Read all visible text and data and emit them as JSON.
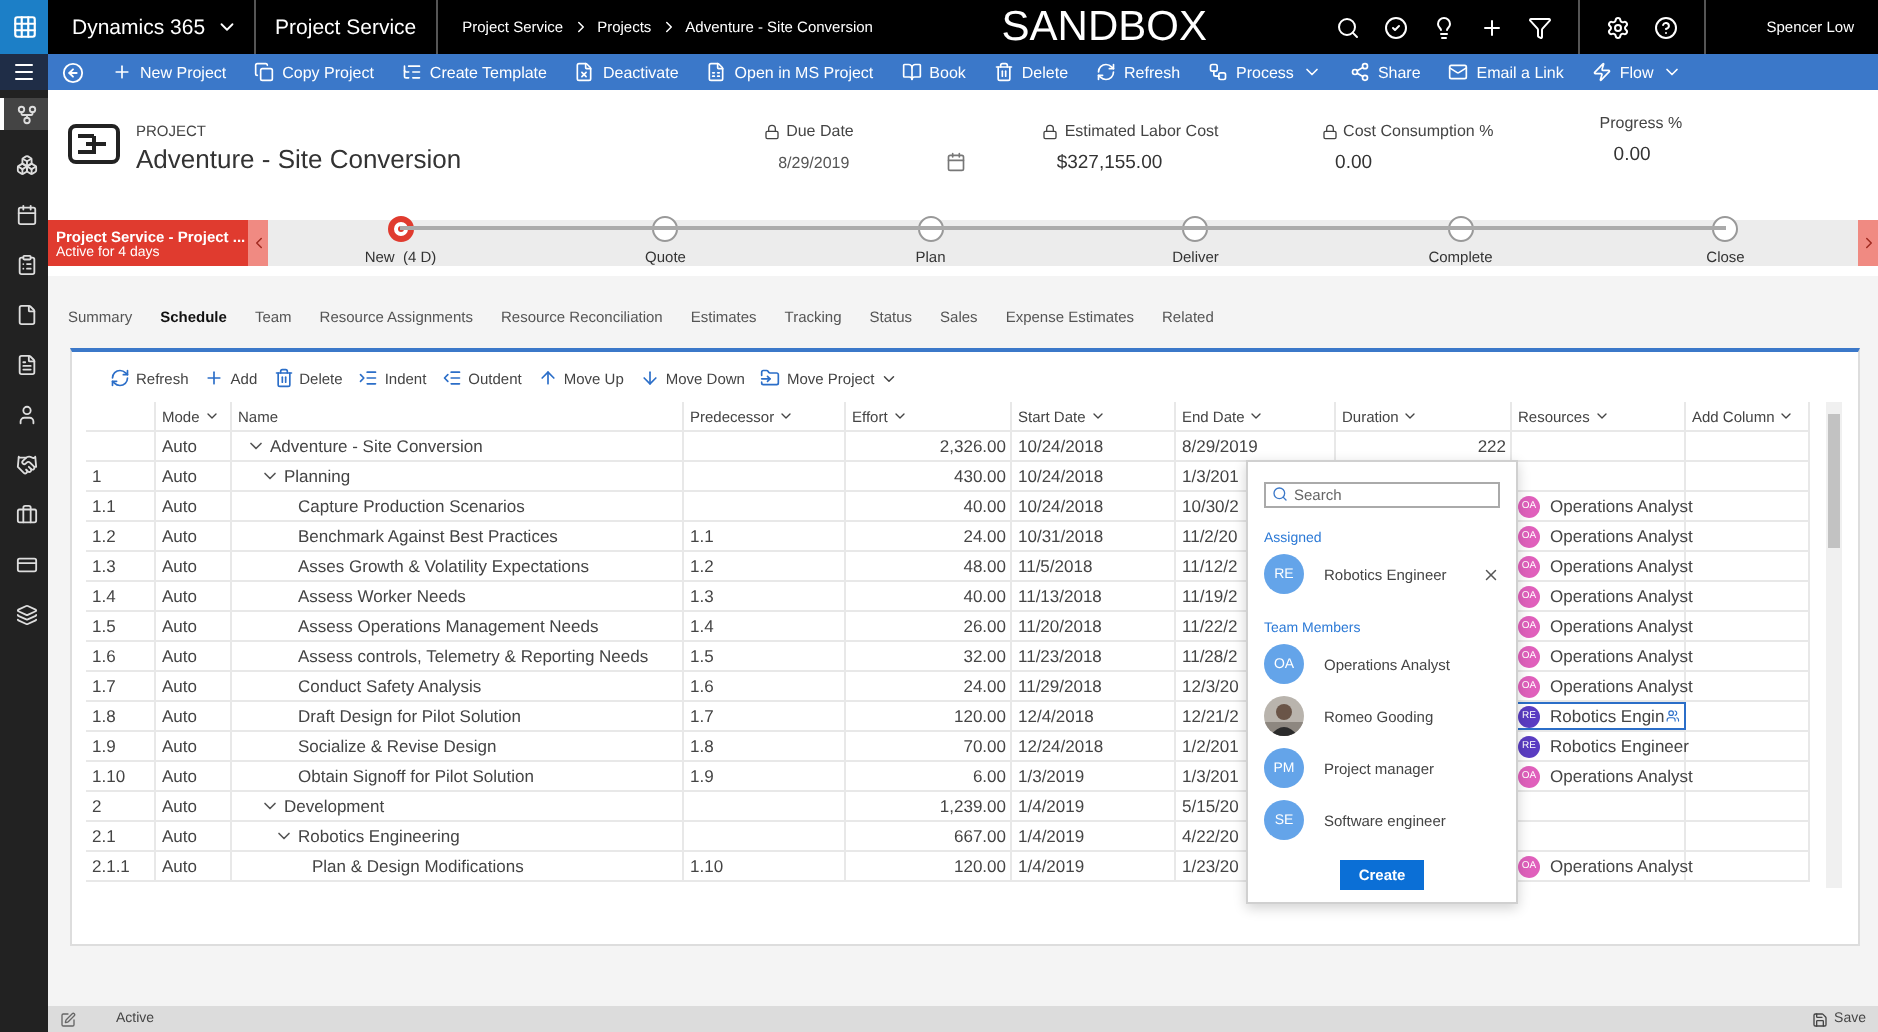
{
  "app_bar": {
    "brand": "Dynamics 365",
    "area": "Project Service",
    "breadcrumb": [
      "Project Service",
      "Projects",
      "Adventure - Site Conversion"
    ],
    "environment": "SANDBOX",
    "user": "Spencer Low"
  },
  "nav": [
    {
      "selected": true
    },
    {
      "selected": false
    },
    {
      "selected": false
    },
    {
      "selected": false
    },
    {
      "selected": false
    },
    {
      "selected": false
    },
    {
      "selected": false
    },
    {
      "selected": false
    },
    {
      "selected": false
    },
    {
      "selected": false
    },
    {
      "selected": false
    }
  ],
  "commands": [
    {
      "label": "New Project",
      "dropdown": false
    },
    {
      "label": "Copy Project",
      "dropdown": false
    },
    {
      "label": "Create Template",
      "dropdown": false
    },
    {
      "label": "Deactivate",
      "dropdown": false
    },
    {
      "label": "Open in MS Project",
      "dropdown": false
    },
    {
      "label": "Book",
      "dropdown": false
    },
    {
      "label": "Delete",
      "dropdown": false
    },
    {
      "label": "Refresh",
      "dropdown": false
    },
    {
      "label": "Process",
      "dropdown": true
    },
    {
      "label": "Share",
      "dropdown": false
    },
    {
      "label": "Email a Link",
      "dropdown": false
    },
    {
      "label": "Flow",
      "dropdown": true
    }
  ],
  "header": {
    "entity": "PROJECT",
    "name": "Adventure - Site Conversion",
    "fields": [
      {
        "label": "Due Date",
        "locked": true,
        "value": "8/29/2019",
        "kind": "date"
      },
      {
        "label": "Estimated Labor Cost",
        "locked": true,
        "value": "$327,155.00",
        "kind": "text"
      },
      {
        "label": "Cost Consumption %",
        "locked": true,
        "value": "0.00",
        "kind": "text"
      },
      {
        "label": "Progress %",
        "locked": false,
        "value": "0.00",
        "kind": "text"
      }
    ]
  },
  "process": {
    "title": "Project Service - Project ...",
    "status": "Active for 4 days",
    "stages": [
      {
        "label": "New  (4 D)",
        "selected": true
      },
      {
        "label": "Quote",
        "selected": false
      },
      {
        "label": "Plan",
        "selected": false
      },
      {
        "label": "Deliver",
        "selected": false
      },
      {
        "label": "Complete",
        "selected": false
      },
      {
        "label": "Close",
        "selected": false
      }
    ]
  },
  "tabs": [
    {
      "label": "Summary",
      "selected": false
    },
    {
      "label": "Schedule",
      "selected": true
    },
    {
      "label": "Team",
      "selected": false
    },
    {
      "label": "Resource Assignments",
      "selected": false
    },
    {
      "label": "Resource Reconciliation",
      "selected": false
    },
    {
      "label": "Estimates",
      "selected": false
    },
    {
      "label": "Tracking",
      "selected": false
    },
    {
      "label": "Status",
      "selected": false
    },
    {
      "label": "Sales",
      "selected": false
    },
    {
      "label": "Expense Estimates",
      "selected": false
    },
    {
      "label": "Related",
      "selected": false
    }
  ],
  "grid": {
    "toolbar": [
      {
        "label": "Refresh",
        "dropdown": false
      },
      {
        "label": "Add",
        "dropdown": false
      },
      {
        "label": "Delete",
        "dropdown": false
      },
      {
        "label": "Indent",
        "dropdown": false
      },
      {
        "label": "Outdent",
        "dropdown": false
      },
      {
        "label": "Move Up",
        "dropdown": false
      },
      {
        "label": "Move Down",
        "dropdown": false
      },
      {
        "label": "Move Project",
        "dropdown": true
      }
    ],
    "columns": [
      {
        "label": "Mode",
        "menu": true
      },
      {
        "label": "Name",
        "menu": false
      },
      {
        "label": "Predecessor",
        "menu": true
      },
      {
        "label": "Effort",
        "menu": true
      },
      {
        "label": "Start Date",
        "menu": true
      },
      {
        "label": "End Date",
        "menu": true
      },
      {
        "label": "Duration",
        "menu": true
      },
      {
        "label": "Resources",
        "menu": true
      },
      {
        "label": "Add Column",
        "menu": true
      }
    ],
    "rows": [
      {
        "mode": "Auto",
        "name": "Adventure - Site Conversion",
        "effort": "2,326.00",
        "start": "10/24/2018",
        "end": "8/29/2019",
        "duration": "222",
        "expanded": true,
        "children": [
          {
            "number": "1",
            "mode": "Auto",
            "name": "Planning",
            "effort": "430.00",
            "start": "10/24/2018",
            "end": "1/3/201",
            "expanded": true,
            "children": [
              {
                "number": "1.1",
                "mode": "Auto",
                "name": "Capture Production Scenarios",
                "effort": "40.00",
                "start": "10/24/2018",
                "end": "10/30/2",
                "resource": {
                  "initials": "OA",
                  "name": "Operations Analyst",
                  "color": "#e060bc",
                  "focused": false
                }
              },
              {
                "number": "1.2",
                "mode": "Auto",
                "name": "Benchmark Against Best Practices",
                "predecessor": "1.1",
                "effort": "24.00",
                "start": "10/31/2018",
                "end": "11/2/20",
                "resource": {
                  "initials": "OA",
                  "name": "Operations Analyst",
                  "color": "#e060bc",
                  "focused": false
                }
              },
              {
                "number": "1.3",
                "mode": "Auto",
                "name": "Asses Growth & Volatility Expectations",
                "predecessor": "1.2",
                "effort": "48.00",
                "start": "11/5/2018",
                "end": "11/12/2",
                "resource": {
                  "initials": "OA",
                  "name": "Operations Analyst",
                  "color": "#e060bc",
                  "focused": false
                }
              },
              {
                "number": "1.4",
                "mode": "Auto",
                "name": "Assess Worker Needs",
                "predecessor": "1.3",
                "effort": "40.00",
                "start": "11/13/2018",
                "end": "11/19/2",
                "resource": {
                  "initials": "OA",
                  "name": "Operations Analyst",
                  "color": "#e060bc",
                  "focused": false
                }
              },
              {
                "number": "1.5",
                "mode": "Auto",
                "name": "Assess Operations Management Needs",
                "predecessor": "1.4",
                "effort": "26.00",
                "start": "11/20/2018",
                "end": "11/22/2",
                "resource": {
                  "initials": "OA",
                  "name": "Operations Analyst",
                  "color": "#e060bc",
                  "focused": false
                }
              },
              {
                "number": "1.6",
                "mode": "Auto",
                "name": "Assess controls, Telemetry & Reporting Needs",
                "predecessor": "1.5",
                "effort": "32.00",
                "start": "11/23/2018",
                "end": "11/28/2",
                "resource": {
                  "initials": "OA",
                  "name": "Operations Analyst",
                  "color": "#e060bc",
                  "focused": false
                }
              },
              {
                "number": "1.7",
                "mode": "Auto",
                "name": "Conduct Safety Analysis",
                "predecessor": "1.6",
                "effort": "24.00",
                "start": "11/29/2018",
                "end": "12/3/20",
                "resource": {
                  "initials": "OA",
                  "name": "Operations Analyst",
                  "color": "#e060bc",
                  "focused": false
                }
              },
              {
                "number": "1.8",
                "mode": "Auto",
                "name": "Draft Design for Pilot Solution",
                "predecessor": "1.7",
                "effort": "120.00",
                "start": "12/4/2018",
                "end": "12/21/2",
                "resource": {
                  "initials": "RE",
                  "name": "Robotics Engin",
                  "color": "#5a3cc2",
                  "focused": true
                }
              },
              {
                "number": "1.9",
                "mode": "Auto",
                "name": "Socialize & Revise Design",
                "predecessor": "1.8",
                "effort": "70.00",
                "start": "12/24/2018",
                "end": "1/2/201",
                "resource": {
                  "initials": "RE",
                  "name": "Robotics Engineer",
                  "color": "#5a3cc2",
                  "focused": false
                }
              },
              {
                "number": "1.10",
                "mode": "Auto",
                "name": "Obtain Signoff for Pilot Solution",
                "predecessor": "1.9",
                "effort": "6.00",
                "start": "1/3/2019",
                "end": "1/3/201",
                "resource": {
                  "initials": "OA",
                  "name": "Operations Analyst",
                  "color": "#e060bc",
                  "focused": false
                }
              }
            ]
          },
          {
            "number": "2",
            "mode": "Auto",
            "name": "Development",
            "effort": "1,239.00",
            "start": "1/4/2019",
            "end": "5/15/20",
            "expanded": true,
            "children": [
              {
                "number": "2.1",
                "mode": "Auto",
                "name": "Robotics Engineering",
                "effort": "667.00",
                "start": "1/4/2019",
                "end": "4/22/20",
                "expanded": true,
                "children": [
                  {
                    "number": "2.1.1",
                    "mode": "Auto",
                    "name": "Plan & Design Modifications",
                    "predecessor": "1.10",
                    "effort": "120.00",
                    "start": "1/4/2019",
                    "end": "1/23/20",
                    "resource": {
                      "initials": "OA",
                      "name": "Operations Analyst",
                      "color": "#e060bc",
                      "focused": false
                    }
                  }
                ]
              }
            ]
          }
        ]
      }
    ]
  },
  "resource_picker": {
    "search_placeholder": "Search",
    "assigned_label": "Assigned",
    "assigned": [
      {
        "initials": "RE",
        "name": "Robotics Engineer"
      }
    ],
    "team_label": "Team Members",
    "team": [
      {
        "kind": "initials",
        "initials": "OA",
        "name": "Operations Analyst"
      },
      {
        "name": "Romeo Gooding"
      },
      {
        "kind": "initials",
        "initials": "PM",
        "name": "Project manager"
      },
      {
        "kind": "initials",
        "initials": "SE",
        "name": "Software engineer"
      }
    ],
    "action": "Create"
  },
  "status_bar": {
    "status": "Active",
    "save": "Save"
  }
}
